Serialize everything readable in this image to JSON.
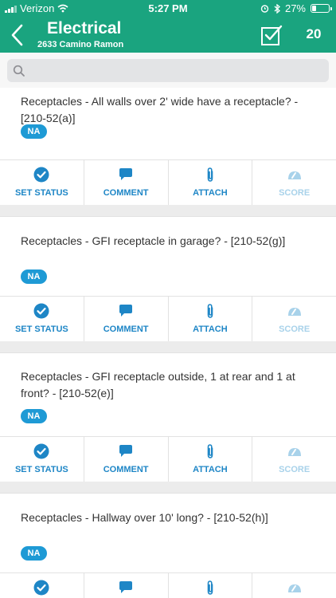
{
  "status_bar": {
    "carrier": "Verizon",
    "time": "5:27 PM",
    "battery": "27%",
    "battery_level": 0.27
  },
  "header": {
    "title": "Electrical",
    "subtitle": "2633 Camino Ramon",
    "count": "20"
  },
  "search": {
    "placeholder": ""
  },
  "colors": {
    "brand": "#1aa47f",
    "accent": "#1e86c6",
    "badge": "#1e9ad5"
  },
  "actions": [
    {
      "label": "SET STATUS",
      "icon": "check-circle-icon"
    },
    {
      "label": "COMMENT",
      "icon": "comment-icon"
    },
    {
      "label": "ATTACH",
      "icon": "paperclip-icon"
    },
    {
      "label": "SCORE",
      "icon": "gauge-icon"
    }
  ],
  "items": [
    {
      "question": "Receptacles - All walls over 2' wide have a receptacle? - [210-52(a)]",
      "status": "NA"
    },
    {
      "question": "Receptacles - GFI receptacle in garage? - [210-52(g)]",
      "status": "NA"
    },
    {
      "question": "Receptacles - GFI receptacle outside, 1 at rear and 1 at front? - [210-52(e)]",
      "status": "NA"
    },
    {
      "question": "Receptacles - Hallway over 10' long? - [210-52(h)]",
      "status": "NA"
    }
  ]
}
